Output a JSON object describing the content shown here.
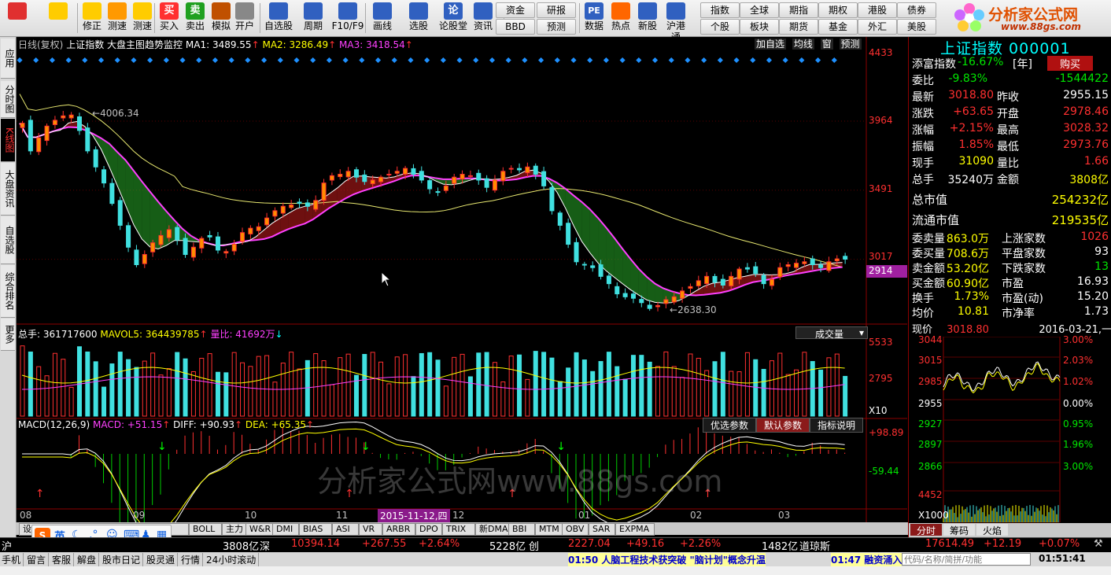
{
  "toolbar": {
    "buttons": [
      {
        "label": "",
        "icon": "app-menu-icon"
      },
      {
        "label": "",
        "icon": "back-arrow-icon"
      },
      {
        "label": "修正",
        "icon": "up-down-icon"
      },
      {
        "label": "测速",
        "icon": "speed-icon"
      },
      {
        "label": "测速",
        "icon": "clock-icon"
      },
      {
        "label": "买入",
        "icon": "buy-icon",
        "glyph": "买"
      },
      {
        "label": "卖出",
        "icon": "sell-icon",
        "glyph": "卖"
      },
      {
        "label": "模拟",
        "icon": "hammer-icon"
      },
      {
        "label": "开户",
        "icon": "lock-icon"
      },
      {
        "label": "自选股",
        "icon": "star-icon"
      },
      {
        "label": "周期",
        "icon": "period-icon"
      },
      {
        "label": "F10/F9",
        "icon": "f10-icon"
      },
      {
        "label": "画线",
        "icon": "pen-icon"
      },
      {
        "label": "选股",
        "icon": "screen-icon"
      },
      {
        "label": "论股堂",
        "icon": "forum-icon",
        "glyph": "论"
      },
      {
        "label": "资讯",
        "icon": "news-icon"
      }
    ],
    "mid_buttons": [
      [
        "资金",
        "研报"
      ],
      [
        "BBD",
        "预测"
      ]
    ],
    "icon_buttons": [
      {
        "label": "数据",
        "icon": "pe-icon",
        "glyph": "PE"
      },
      {
        "label": "热点",
        "icon": "fire-icon"
      },
      {
        "label": "新股",
        "icon": "new-stock-icon"
      },
      {
        "label": "沪港通",
        "icon": "hk-connect-icon"
      }
    ],
    "grid_buttons": [
      [
        "指数",
        "全球",
        "期指",
        "期权",
        "港股",
        "债券"
      ],
      [
        "个股",
        "板块",
        "期货",
        "基金",
        "外汇",
        "美股"
      ]
    ],
    "logo_text": "分析家公式网",
    "logo_url": "www.88gs.com"
  },
  "left_tabs": [
    "应用",
    "分时图",
    "K线图",
    "大盘资讯",
    "自选股",
    "综合排名",
    "更多"
  ],
  "chart": {
    "header": {
      "period": "日线(复权)",
      "name": "上证指数",
      "indicator": "大盘主图趋势监控",
      "ma1": "MA1: 3489.55",
      "ma2": "MA2: 3286.49",
      "ma3": "MA3: 3418.54",
      "buttons": [
        "加自选",
        "均线",
        "窗",
        "预测"
      ]
    },
    "price_labels": [
      "4433",
      "3964",
      "3491",
      "3017"
    ],
    "current_price_tag": "2914",
    "high_label": "4006.34",
    "low_label": "2638.30",
    "volume_header": {
      "total": "总手: 361717600",
      "mavol": "MAVOL5: 364439785",
      "ratio": "量比: 41692万",
      "dropdown": "成交量"
    },
    "volume_labels": [
      "5533",
      "2795",
      "X10"
    ],
    "macd_header": {
      "name": "MACD(12,26,9)",
      "macd": "MACD: +51.15",
      "diff": "DIFF: +90.93",
      "dea": "DEA: +65.35",
      "buttons": [
        "优选参数",
        "默认参数",
        "指标说明"
      ]
    },
    "macd_labels": [
      "+98.89",
      "-59.44"
    ],
    "x_labels": [
      "08",
      "09",
      "10",
      "11",
      "12",
      "01",
      "02",
      "03"
    ],
    "cursor_date": "2015-11-12,四",
    "watermark": "分析家公式网www.88gs.com"
  },
  "chart_data": {
    "type": "candlestick",
    "title": "上证指数",
    "yrange": [
      2600,
      4433
    ],
    "closes": [
      3950,
      3760,
      3850,
      3930,
      3970,
      4000,
      4006,
      3900,
      3760,
      3650,
      3540,
      3400,
      3250,
      3100,
      2980,
      3050,
      3130,
      3180,
      3220,
      3150,
      3050,
      3100,
      3160,
      3170,
      3080,
      3070,
      3120,
      3200,
      3230,
      3240,
      3300,
      3350,
      3380,
      3390,
      3400,
      3380,
      3420,
      3540,
      3590,
      3600,
      3620,
      3580,
      3550,
      3560,
      3580,
      3600,
      3620,
      3640,
      3600,
      3560,
      3500,
      3480,
      3520,
      3580,
      3600,
      3590,
      3560,
      3510,
      3560,
      3620,
      3640,
      3630,
      3650,
      3600,
      3520,
      3350,
      3250,
      3120,
      3000,
      2980,
      2960,
      2900,
      2850,
      2780,
      2760,
      2750,
      2720,
      2680,
      2700,
      2740,
      2760,
      2800,
      2830,
      2870,
      2900,
      2860,
      2840,
      2900,
      2950,
      2950,
      2920,
      2850,
      2880,
      2960,
      2980,
      2990,
      3000,
      2980,
      2960,
      3000,
      3020,
      3018
    ]
  },
  "right_panel": {
    "title": "上证指数 000001",
    "quote_rows": [
      {
        "label": "添富指数",
        "value": "-16.67%",
        "extra": "[年]",
        "action": "购买"
      },
      {
        "label": "委比",
        "value": "-9.83%",
        "value2": "-1544422"
      },
      {
        "label": "最新",
        "value": "3018.80",
        "label2": "昨收",
        "value2": "2955.15"
      },
      {
        "label": "涨跌",
        "value": "+63.65",
        "label2": "开盘",
        "value2": "2978.46"
      },
      {
        "label": "涨幅",
        "value": "+2.15%",
        "label2": "最高",
        "value2": "3028.32"
      },
      {
        "label": "振幅",
        "value": "1.85%",
        "label2": "最低",
        "value2": "2973.76"
      },
      {
        "label": "现手",
        "value": "31090",
        "label2": "量比",
        "value2": "1.66"
      },
      {
        "label": "总手",
        "value": "35240万",
        "label2": "金额",
        "value2": "3808亿"
      }
    ],
    "cap_rows": [
      {
        "label": "总市值",
        "value": "254232亿"
      },
      {
        "label": "流通市值",
        "value": "219535亿"
      }
    ],
    "breadth_rows": [
      {
        "label": "委卖量",
        "value": "863.0万",
        "label2": "上涨家数",
        "value2": "1026"
      },
      {
        "label": "委买量",
        "value": "708.6万",
        "label2": "平盘家数",
        "value2": "93"
      },
      {
        "label": "卖金额",
        "value": "53.20亿",
        "label2": "下跌家数",
        "value2": "13"
      },
      {
        "label": "买金额",
        "value": "60.90亿",
        "label2": "市盈",
        "value2": "16.93"
      },
      {
        "label": "换手",
        "value": "1.73%",
        "label2": "市盈(动)",
        "value2": "15.20"
      },
      {
        "label": "均价",
        "value": "10.81",
        "label2": "市净率",
        "value2": "1.73"
      }
    ],
    "mini": {
      "label": "现价",
      "price": "3018.80",
      "date": "2016-03-21,一",
      "left_labels": [
        "3044",
        "3015",
        "2985",
        "2955",
        "2927",
        "2897",
        "2866",
        "4452",
        "X1000"
      ],
      "right_labels": [
        "3.00%",
        "2.03%",
        "1.02%",
        "0.00%",
        "0.95%",
        "1.96%",
        "3.00%"
      ]
    },
    "tabs": [
      "分时",
      "筹码",
      "火焰"
    ]
  },
  "indicator_tabs": [
    "设置",
    "BOLL",
    "主力",
    "W&R",
    "DMI",
    "BIAS",
    "ASI",
    "VR",
    "ARBR",
    "DPO",
    "TRIX",
    "新DMA",
    "BBI",
    "MTM",
    "OBV",
    "SAR",
    "EXPMA"
  ],
  "status_bar": {
    "sh_label": "沪",
    "sh_amount": "3808亿",
    "sz_label": "深",
    "sz_index": "10394.14",
    "sz_change": "+267.55",
    "sz_pct": "+2.64%",
    "sz_amount": "5228亿",
    "cy_label": "创",
    "cy_index": "2227.04",
    "cy_change": "+49.16",
    "cy_pct": "+2.26%",
    "cy_amount": "1482亿",
    "dj_label": "道琼斯",
    "dj_index": "17614.49",
    "dj_change": "+12.19",
    "dj_pct": "+0.07%"
  },
  "menu_bar": {
    "items": [
      "手机",
      "留言",
      "客服",
      "解盘",
      "股市日记",
      "股灵通",
      "行情",
      "24小时滚动"
    ],
    "news1": "01:50 人脑工程技术获突破 \"脑计划\"概念升温",
    "news2": "01:47 融资涌入",
    "search_placeholder": "代码/名称/简拼/功能",
    "clock": "01:51:41"
  },
  "ime": {
    "label": "英"
  }
}
